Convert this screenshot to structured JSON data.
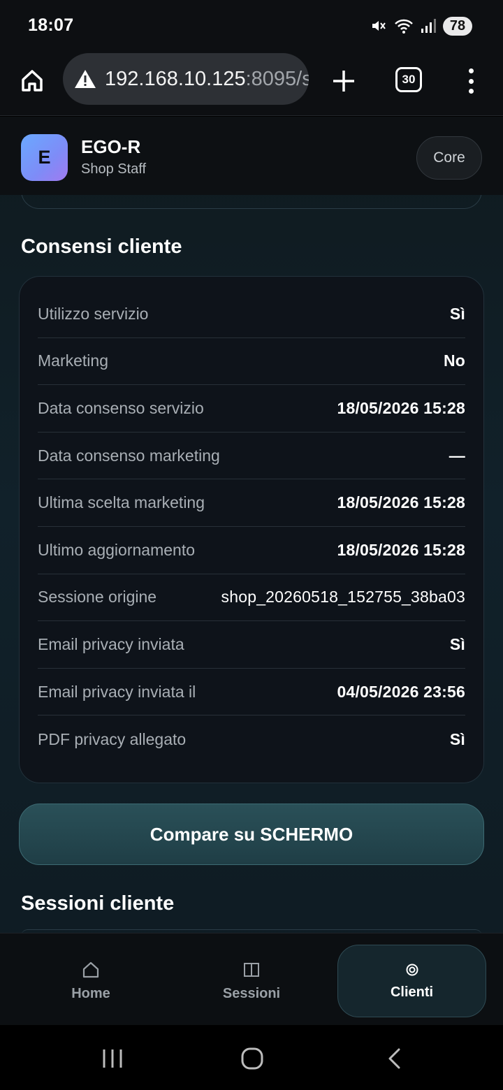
{
  "status_bar": {
    "time": "18:07",
    "battery": "78",
    "icons": [
      "mute-icon",
      "wifi-icon",
      "signal-icon",
      "battery-icon"
    ]
  },
  "browser": {
    "url_host": "192.168.10.125",
    "url_rest": ":8095/s",
    "tabs_count": "30",
    "icons": [
      "home-icon",
      "warning-icon",
      "plus-icon",
      "tabs-icon",
      "more-icon"
    ]
  },
  "app": {
    "logo_letter": "E",
    "name": "EGO-R",
    "subtitle": "Shop Staff",
    "core_button": "Core"
  },
  "consents": {
    "title": "Consensi cliente",
    "rows": [
      {
        "label": "Utilizzo servizio",
        "value": "Sì"
      },
      {
        "label": "Marketing",
        "value": "No"
      },
      {
        "label": "Data consenso servizio",
        "value": "18/05/2026 15:28"
      },
      {
        "label": "Data consenso marketing",
        "value": "—"
      },
      {
        "label": "Ultima scelta marketing",
        "value": "18/05/2026 15:28"
      },
      {
        "label": "Ultimo aggiornamento",
        "value": "18/05/2026 15:28"
      },
      {
        "label": "Sessione origine",
        "value": "shop_20260518_152755_38ba03"
      },
      {
        "label": "Email privacy inviata",
        "value": "Sì"
      },
      {
        "label": "Email privacy inviata il",
        "value": "04/05/2026 23:56"
      },
      {
        "label": "PDF privacy allegato",
        "value": "Sì"
      }
    ]
  },
  "show_button": "Compare su SCHERMO",
  "sessions": {
    "title": "Sessioni cliente"
  },
  "bottom_nav": {
    "items": [
      {
        "label": "Home",
        "icon": "home-icon",
        "active": false
      },
      {
        "label": "Sessioni",
        "icon": "columns-icon",
        "active": false
      },
      {
        "label": "Clienti",
        "icon": "target-icon",
        "active": true
      }
    ]
  },
  "system_nav": [
    "recents-icon",
    "home-circle-icon",
    "back-icon"
  ]
}
